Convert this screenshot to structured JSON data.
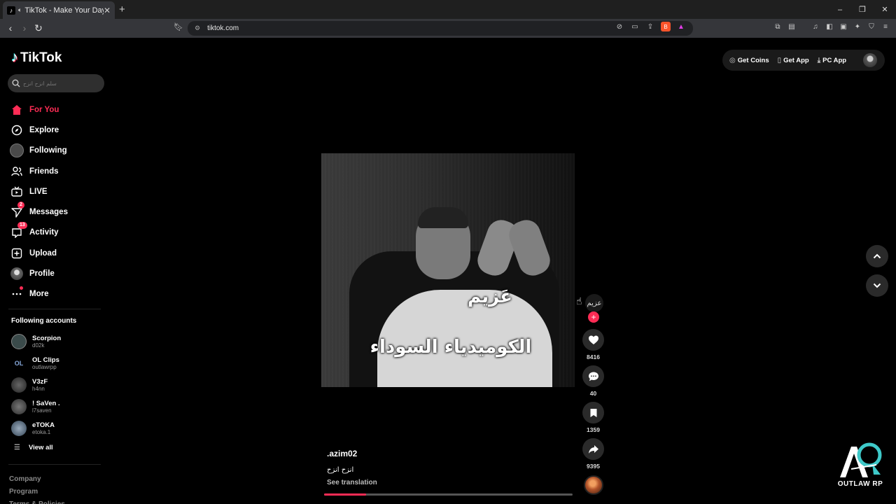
{
  "browser": {
    "tab_title": "TikTok - Make Your Day",
    "url": "tiktok.com",
    "window_controls": [
      "–",
      "▢",
      "✕"
    ]
  },
  "tiktok": {
    "logo_text": "TikTok",
    "search_placeholder": "سلم انزح انزح",
    "nav": [
      {
        "label": "For You",
        "icon": "home-icon",
        "active": true
      },
      {
        "label": "Explore",
        "icon": "compass-icon"
      },
      {
        "label": "Following",
        "icon": "following-avatar-icon"
      },
      {
        "label": "Friends",
        "icon": "friends-icon"
      },
      {
        "label": "LIVE",
        "icon": "live-tv-icon"
      },
      {
        "label": "Messages",
        "icon": "paper-plane-icon",
        "badge": "2"
      },
      {
        "label": "Activity",
        "icon": "activity-icon",
        "badge": "13"
      },
      {
        "label": "Upload",
        "icon": "upload-plus-icon"
      },
      {
        "label": "Profile",
        "icon": "profile-avatar-icon"
      },
      {
        "label": "More",
        "icon": "more-dots-icon"
      }
    ],
    "following_title": "Following accounts",
    "following_accounts": [
      {
        "name": "Scorpion",
        "handle": "d02k",
        "color": "#3a4a4a"
      },
      {
        "name": "OL Clips",
        "handle": "outlawrpp",
        "color": "#1c2a33"
      },
      {
        "name": "V3zF",
        "handle": "h4nn",
        "color": "#3a3a3a"
      },
      {
        "name": "! SaVen .",
        "handle": "l7saven",
        "color": "#444444"
      },
      {
        "name": "eTOKA",
        "handle": "etoka.1",
        "color": "#5a6a7a"
      }
    ],
    "view_all": "View all",
    "footer_links": [
      "Company",
      "Program",
      "Terms & Policies"
    ],
    "top_actions": {
      "get_coins": "Get Coins",
      "get_app": "Get App",
      "pc_app": "PC App"
    },
    "video": {
      "caption_line1": "عَزيم",
      "caption_line2": "الكوميدياء السوداء",
      "author": ".azim02",
      "description": "انزح انزح",
      "see_translation": "See translation",
      "progress": 0.17
    },
    "actions": {
      "likes": "8416",
      "comments": "40",
      "saves": "1359",
      "shares": "9395"
    },
    "creator_avatar_text": "عزيم",
    "watermark_text": "OUTLAW RP",
    "colors": {
      "accent": "#fe2c55",
      "background": "#000000"
    }
  }
}
